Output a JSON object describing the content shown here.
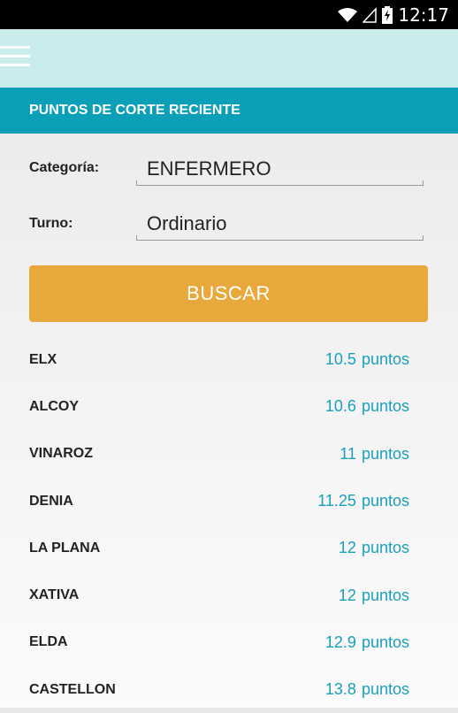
{
  "status_bar": {
    "time": "12:17",
    "icons": [
      "wifi-icon",
      "signal-icon",
      "battery-charging-icon"
    ]
  },
  "app_bar": {
    "menu_icon": "hamburger-menu-icon"
  },
  "section": {
    "title": "PUNTOS DE CORTE RECIENTE"
  },
  "form": {
    "categoria_label": "Categoría:",
    "categoria_value": "ENFERMERO",
    "turno_label": "Turno:",
    "turno_value": "Ordinario"
  },
  "search_button": {
    "label": "BUSCAR",
    "color": "#e8a83c"
  },
  "results": [
    {
      "city": "ELX",
      "points": "10.5",
      "unit": "puntos"
    },
    {
      "city": "ALCOY",
      "points": "10.6",
      "unit": "puntos"
    },
    {
      "city": "VINAROZ",
      "points": "11",
      "unit": "puntos"
    },
    {
      "city": "DENIA",
      "points": "11.25",
      "unit": "puntos"
    },
    {
      "city": "LA PLANA",
      "points": "12",
      "unit": "puntos"
    },
    {
      "city": "XATIVA",
      "points": "12",
      "unit": "puntos"
    },
    {
      "city": "ELDA",
      "points": "12.9",
      "unit": "puntos"
    },
    {
      "city": "CASTELLON",
      "points": "13.8",
      "unit": "puntos"
    }
  ],
  "colors": {
    "header": "#0ba0b8",
    "app_bar": "#c9ecec",
    "points_text": "#1aa0bb"
  }
}
